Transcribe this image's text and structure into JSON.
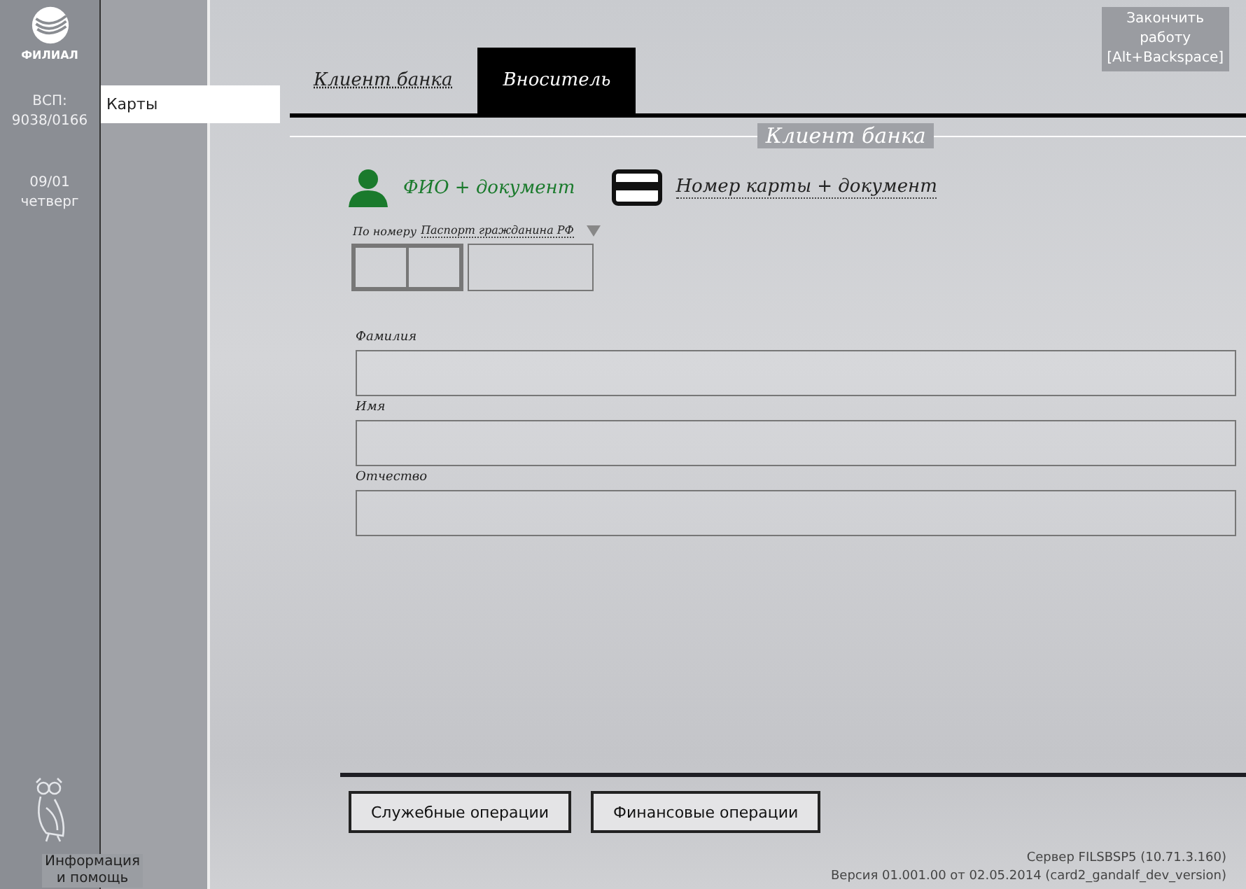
{
  "sidebar": {
    "logo_text": "ФИЛИАЛ",
    "branch_label": "ВСП:",
    "branch_code": "9038/0166",
    "date": "09/01",
    "weekday": "четверг",
    "help": [
      "Информация",
      "и помощь"
    ]
  },
  "menu": [
    {
      "label": "Карты",
      "selected": true
    }
  ],
  "exit": [
    "Закончить",
    "работу",
    "[Alt+Backspace]"
  ],
  "tabs": [
    {
      "label": "Клиент банка",
      "selected": false
    },
    {
      "label": "Вноситель",
      "selected": true
    }
  ],
  "section_title": "Клиент банка",
  "search_modes": [
    {
      "label": "ФИО + документ",
      "kind": "person",
      "selected": true
    },
    {
      "label": "Номер карты + документ",
      "kind": "card",
      "selected": false
    }
  ],
  "document": {
    "prefix": "По номеру",
    "type": "Паспорт гражданина РФ"
  },
  "fields": [
    {
      "label": "Фамилия"
    },
    {
      "label": "Имя"
    },
    {
      "label": "Отчество"
    }
  ],
  "buttons": [
    "Служебные операции",
    "Финансовые операции"
  ],
  "footer": [
    "Сервер FILSBSP5 (10.71.3.160)",
    "Версия 01.001.00 от 02.05.2014 (card2_gandalf_dev_version)"
  ]
}
